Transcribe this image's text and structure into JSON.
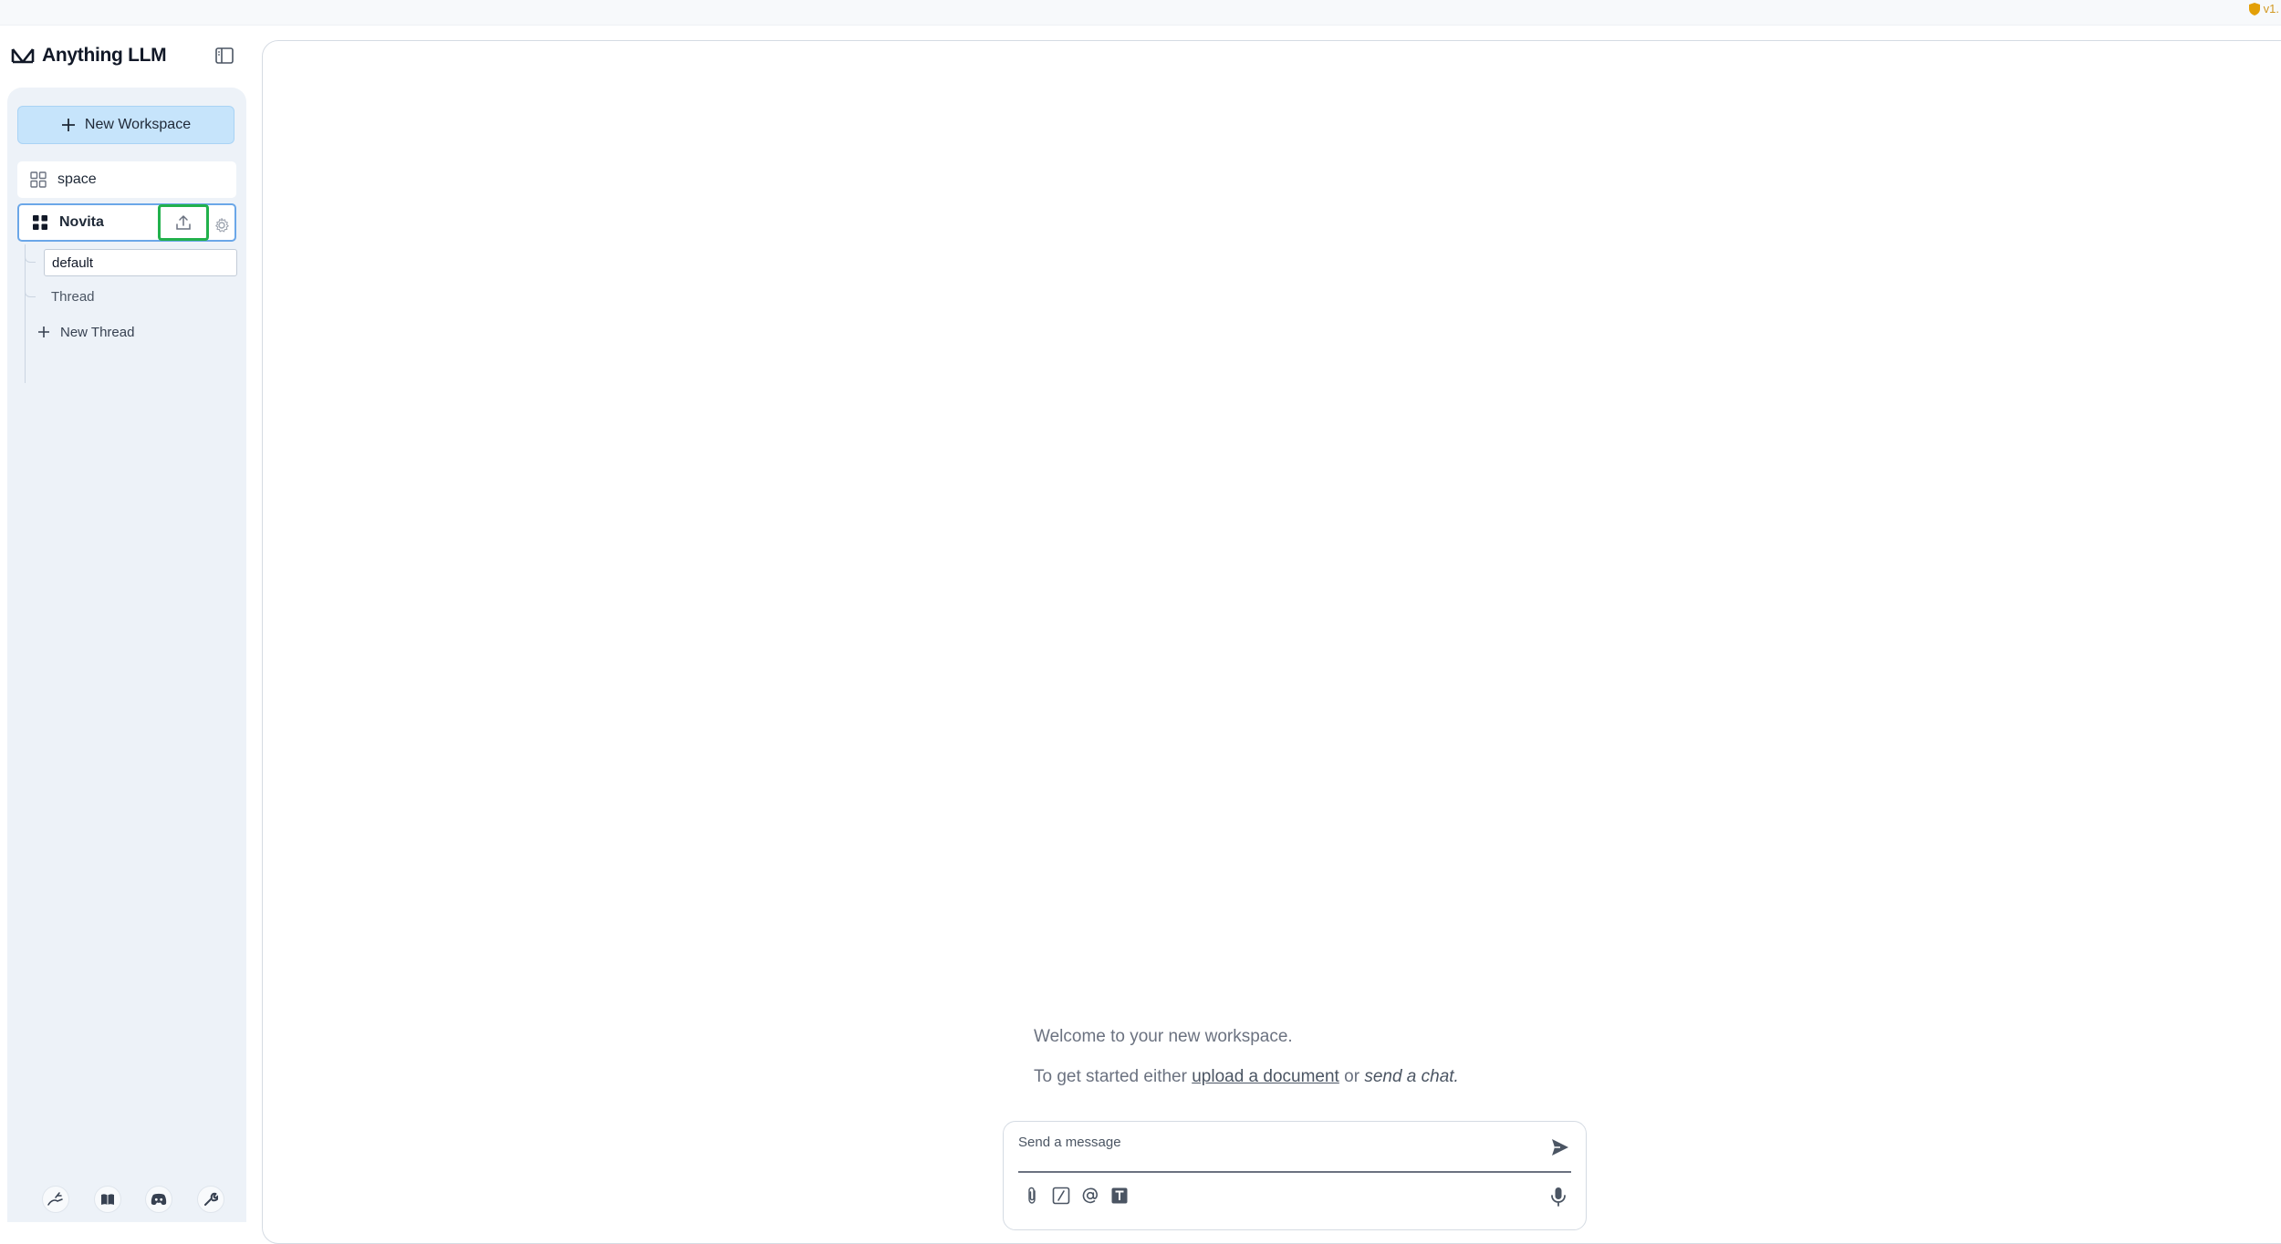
{
  "app": {
    "title": "Anything LLM",
    "version_badge": "v1."
  },
  "sidebar": {
    "new_workspace_label": "New Workspace",
    "workspaces": [
      {
        "name": "space",
        "active": false
      },
      {
        "name": "Novita",
        "active": true
      }
    ],
    "threads": [
      {
        "name": "default",
        "selected": true
      },
      {
        "name": "Thread",
        "selected": false
      }
    ],
    "new_thread_label": "New Thread",
    "footer_icons": [
      "community-hub-icon",
      "docs-book-icon",
      "discord-icon",
      "settings-wrench-icon"
    ]
  },
  "main": {
    "welcome_line": "Welcome to your new workspace.",
    "start_prefix": "To get started either",
    "upload_link": "upload a document",
    "or_text": "or",
    "send_chat_text": "send a chat."
  },
  "composer": {
    "placeholder": "Send a message",
    "value": "",
    "tools": [
      "attach-icon",
      "slash-command-icon",
      "mention-at-icon",
      "text-size-icon"
    ]
  },
  "colors": {
    "accent_blue": "#c6e4fb",
    "active_border": "#6ba7e8",
    "highlight_green": "#22b14c",
    "sidebar_bg": "#edf2f8"
  }
}
